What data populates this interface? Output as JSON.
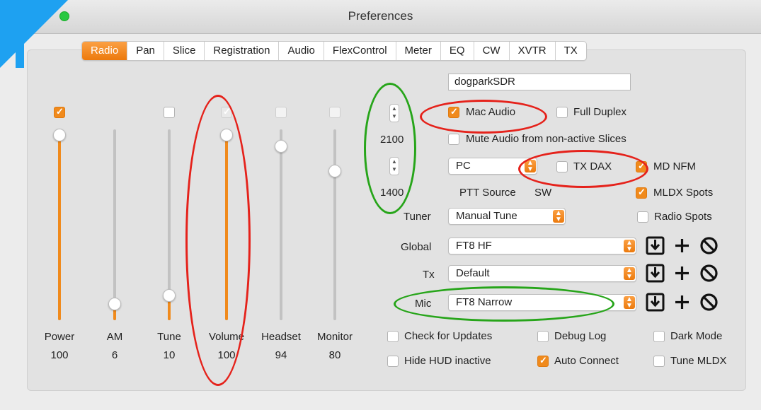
{
  "window": {
    "title": "Preferences"
  },
  "tabs": [
    "Radio",
    "Pan",
    "Slice",
    "Registration",
    "Audio",
    "FlexControl",
    "Meter",
    "EQ",
    "CW",
    "XVTR",
    "TX"
  ],
  "sliders": [
    {
      "label": "Power",
      "value": "100",
      "checked": true,
      "level": 1.0
    },
    {
      "label": "AM",
      "value": "6",
      "checked": null,
      "level": 0.06
    },
    {
      "label": "Tune",
      "value": "10",
      "checked": false,
      "level": 0.1
    },
    {
      "label": "Volume",
      "value": "100",
      "checked": true,
      "level": 1.0
    },
    {
      "label": "Headset",
      "value": "94",
      "checked": false,
      "level": 0.94
    },
    {
      "label": "Monitor",
      "value": "80",
      "checked": false,
      "level": 0.8
    }
  ],
  "steppers": {
    "upper_value": "2100",
    "lower_value": "1400"
  },
  "station": {
    "name": "dogparkSDR"
  },
  "options": {
    "mac_audio": "Mac Audio",
    "full_duplex": "Full Duplex",
    "mute_audio": "Mute Audio from non-active Slices",
    "tx_dax": "TX DAX",
    "md_nfm": "MD NFM",
    "mldx_spots": "MLDX Spots",
    "radio_spots": "Radio Spots"
  },
  "ptt": {
    "select": "PC",
    "label": "PTT Source",
    "source": "SW"
  },
  "tuner": {
    "label": "Tuner",
    "value": "Manual Tune"
  },
  "profiles": [
    {
      "label": "Global",
      "value": "FT8 HF"
    },
    {
      "label": "Tx",
      "value": "Default"
    },
    {
      "label": "Mic",
      "value": "FT8 Narrow"
    }
  ],
  "checks": {
    "check_updates": "Check for Updates",
    "debug_log": "Debug Log",
    "dark_mode": "Dark Mode",
    "hide_hud": "Hide HUD inactive",
    "auto_connect": "Auto Connect",
    "tune_mldx": "Tune MLDX"
  },
  "colors": {
    "accent": "#f08a1c",
    "annotation_red": "#e5221b",
    "annotation_green": "#27a51a",
    "corner_blue": "#1ea1f1"
  }
}
